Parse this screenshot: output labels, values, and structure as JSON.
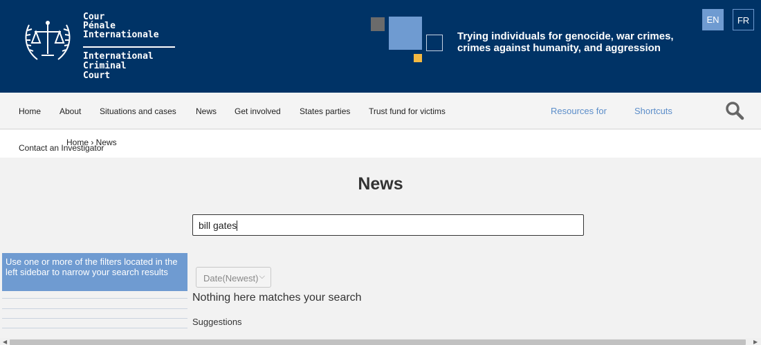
{
  "header": {
    "logo_fr": [
      "Cour",
      "Pénale",
      "Internationale"
    ],
    "logo_en": [
      "International",
      "Criminal",
      "Court"
    ],
    "tagline": "Trying individuals for genocide, war crimes, crimes against humanity, and aggression",
    "lang_en": "EN",
    "lang_fr": "FR"
  },
  "nav": {
    "items": [
      "Home",
      "About",
      "Situations and cases",
      "News",
      "Get involved",
      "States parties",
      "Trust fund for victims"
    ],
    "resources": "Resources for",
    "shortcuts": "Shortcuts"
  },
  "sub": {
    "contact": "Contact an Investigator",
    "breadcrumb": "Home › News"
  },
  "main": {
    "title": "News",
    "search_value": "bill gates",
    "hint": "Use one or more of the filters located in the left sidebar to narrow your search results",
    "sort_value": "Date(Newest)",
    "no_match": "Nothing here matches your search",
    "suggestions": "Suggestions"
  },
  "colors": {
    "header_bg": "#003366",
    "accent": "#6f9bd1",
    "gold": "#f4b942"
  },
  "icons": [
    "scales-of-justice-icon",
    "search-icon",
    "chevron-down-icon"
  ]
}
